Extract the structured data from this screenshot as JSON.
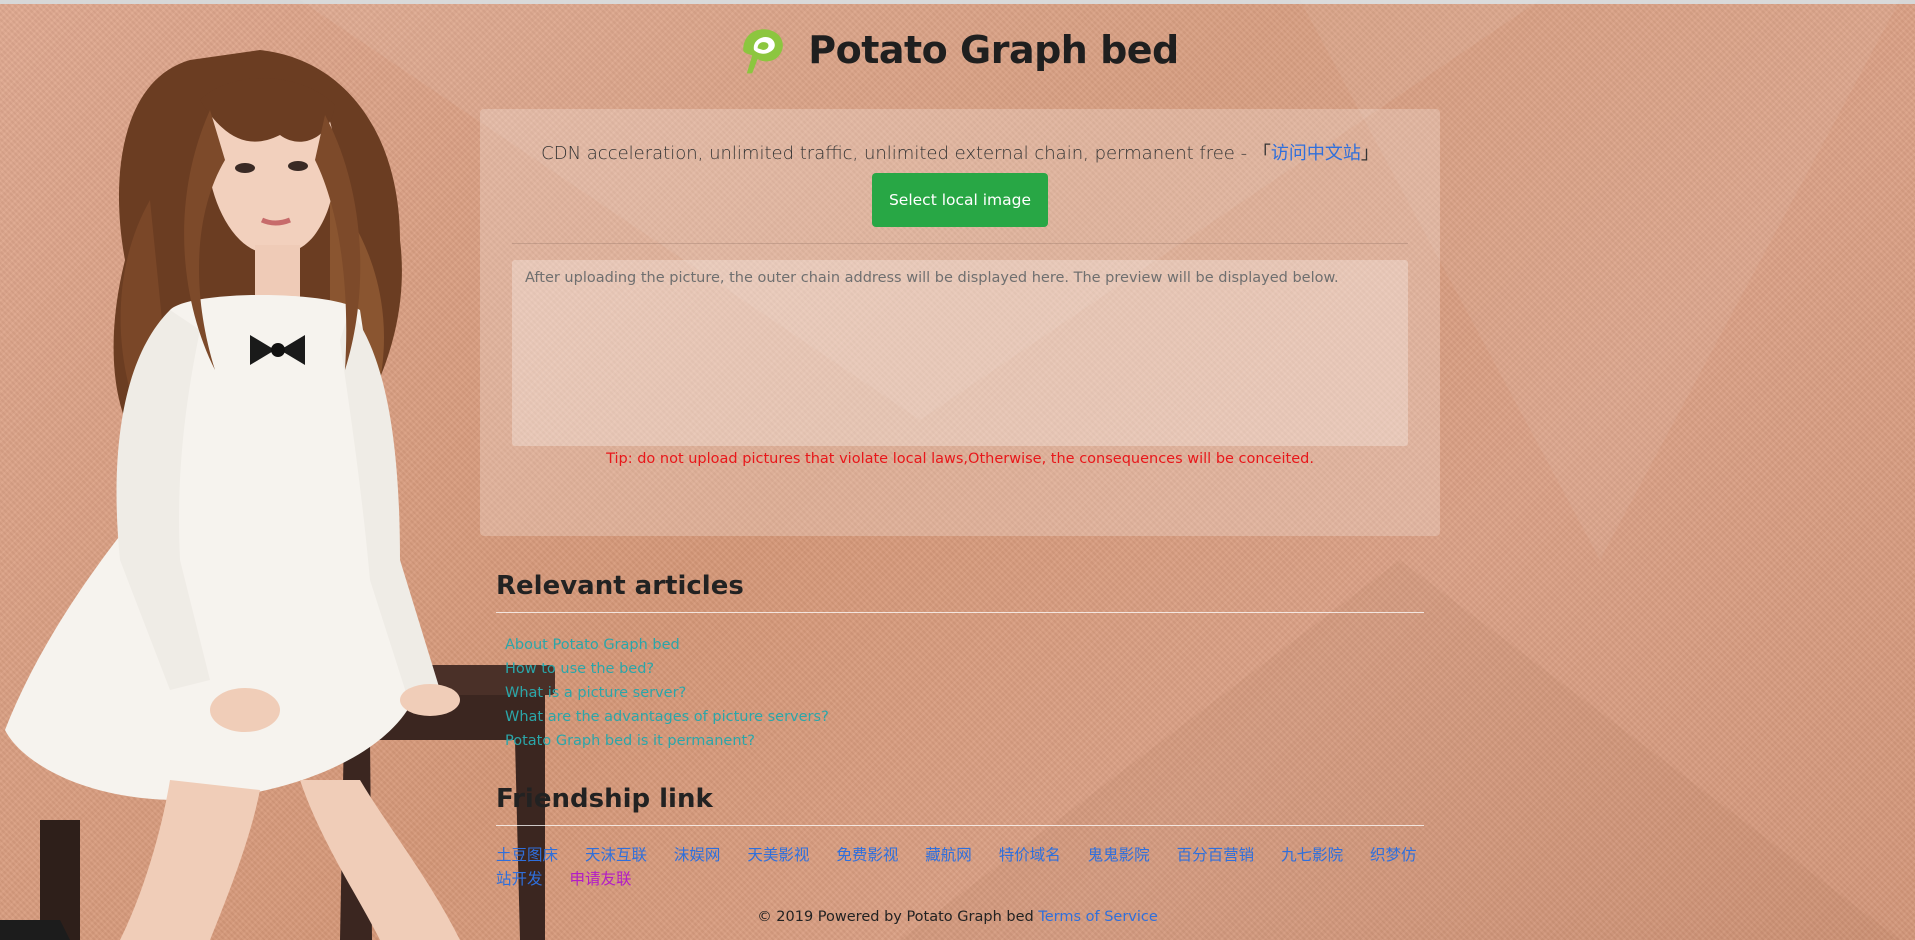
{
  "header": {
    "title": "Potato Graph bed"
  },
  "panel": {
    "tagline_text": "CDN acceleration, unlimited traffic, unlimited external chain, permanent free - ",
    "tagline_bracket_open": "「",
    "tagline_link": "访问中文站",
    "tagline_bracket_close": "」",
    "select_button": "Select local image",
    "result_placeholder": "After uploading the picture, the outer chain address will be displayed here. The preview will be displayed below.",
    "tip": "Tip: do not upload pictures that violate local laws,Otherwise, the consequences will be conceited."
  },
  "articles": {
    "title": "Relevant articles",
    "items": [
      "About Potato Graph bed",
      "How to use the bed?",
      "What is a picture server?",
      "What are the advantages of picture servers?",
      "Potato Graph bed is it permanent?"
    ]
  },
  "friendship": {
    "title": "Friendship link",
    "items": [
      "土豆图床",
      "天沫互联",
      "沫娱网",
      "天美影视",
      "免费影视",
      "藏航网",
      "特价域名",
      "鬼鬼影院",
      "百分百营销",
      "九七影院",
      "织梦仿站开发"
    ],
    "apply": "申请友联"
  },
  "footer": {
    "text": "© 2019 Powered by Potato Graph bed ",
    "terms": "Terms of Service"
  },
  "colors": {
    "accent_green": "#28a745",
    "link_blue": "#2f6fdc",
    "article_teal": "#2ba6a9",
    "tip_red": "#e8171a",
    "apply_purple": "#b21cc7"
  }
}
